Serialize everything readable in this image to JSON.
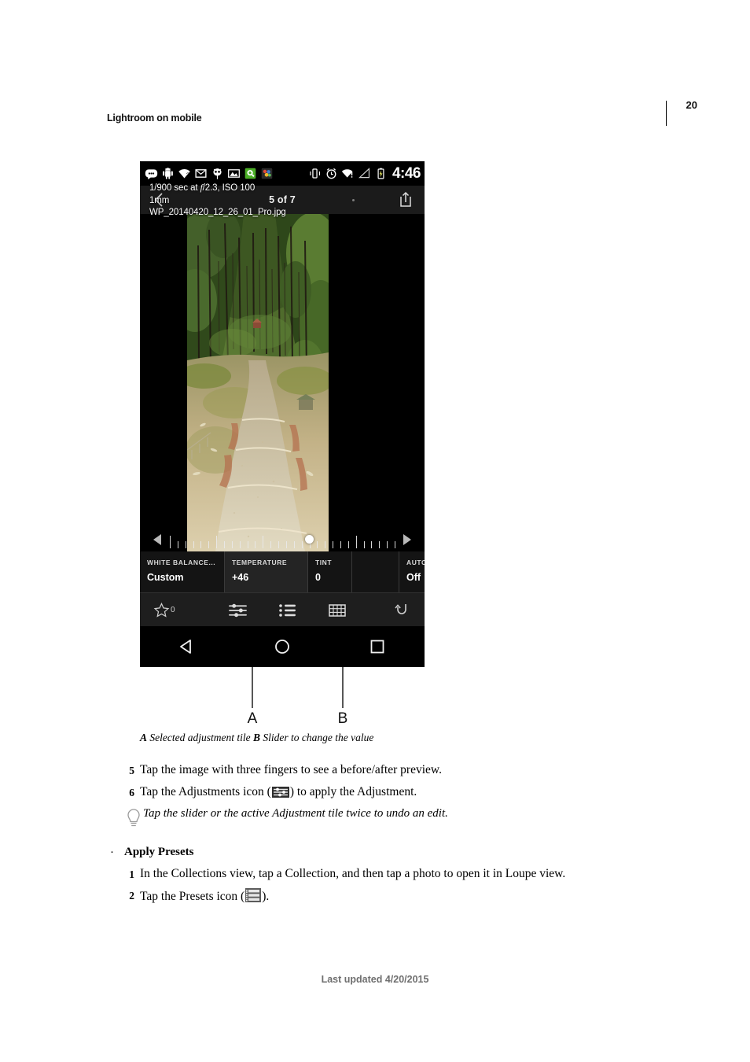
{
  "document": {
    "running_head": "Lightroom on mobile",
    "page_number": "20",
    "footer": "Last updated 4/20/2015"
  },
  "figure": {
    "phone": {
      "status_bar": {
        "time": "4:46",
        "left_icons": [
          "message-icon",
          "android-icon",
          "wifi-question-icon",
          "gmail-icon",
          "owl-app-icon",
          "photo-icon",
          "green-app-icon",
          "colorful-app-icon"
        ],
        "right_icons": [
          "vibrate-icon",
          "alarm-icon",
          "wifi-alert-icon",
          "signal-icon",
          "battery-charging-icon"
        ]
      },
      "nav_bar": {
        "back_icon": "chevron-left-icon",
        "title": "5 of 7",
        "share_icon": "share-up-icon"
      },
      "photo": {
        "exif_line1_a": "1/900 sec at ",
        "exif_line1_italic": "f",
        "exif_line1_b": "/2.3, ISO 100",
        "exif_line2": "1mm",
        "exif_line3": "WP_20140420_12_26_01_Pro.jpg"
      },
      "slider": {
        "left_arrow_icon": "triangle-left-icon",
        "right_arrow_icon": "triangle-right-icon",
        "handle_position_percent": "62"
      },
      "tiles": [
        {
          "label": "WHITE BALANCE...",
          "value": "Custom",
          "selected": "false"
        },
        {
          "label": "TEMPERATURE",
          "value": "+46",
          "selected": "true"
        },
        {
          "label": "TINT",
          "value": "0",
          "selected": "false"
        },
        {
          "label": "",
          "value": "",
          "selected": "false"
        },
        {
          "label": "AUTO T",
          "value": "Off",
          "selected": "false"
        }
      ],
      "toolbar": {
        "star_icon": "star-outline-icon",
        "star_count": "0",
        "adjustments_icon": "sliders-icon",
        "presets_icon": "list-icon",
        "crop_icon": "grid-icon",
        "undo_icon": "undo-arrow-icon"
      },
      "android_nav": {
        "back_icon": "triangle-back-icon",
        "home_icon": "circle-home-icon",
        "recents_icon": "square-recents-icon"
      }
    },
    "callouts": [
      {
        "letter": "A"
      },
      {
        "letter": "B"
      }
    ],
    "caption": {
      "a_label": "A",
      "a_text": " Selected adjustment tile  ",
      "b_label": "B",
      "b_text": " Slider to change the value"
    }
  },
  "content": {
    "steps": [
      {
        "num": "5",
        "text": "Tap the image with three fingers to see a before/after preview."
      },
      {
        "num": "6",
        "text_before": "Tap the Adjustments icon (",
        "icon": "sliders-icon",
        "text_after": ") to apply the Adjustment."
      }
    ],
    "tip": {
      "icon": "lightbulb-icon",
      "text": "Tap the slider or the active Adjustment tile twice to undo an edit."
    },
    "section": {
      "bullet": "·",
      "heading": "Apply Presets",
      "steps": [
        {
          "num": "1",
          "text": "In the Collections view, tap a Collection, and then tap a photo to open it in Loupe view."
        },
        {
          "num": "2",
          "text_before": "Tap the Presets icon (",
          "icon": "presets-icon",
          "text_after": ")."
        }
      ]
    }
  },
  "colors": {
    "phone_bg": "#000000",
    "tile_bg": "#141414",
    "tile_selected_bg": "#242424",
    "toolbar_bg": "#1e1e1e",
    "accent_text": "#ffffff"
  }
}
